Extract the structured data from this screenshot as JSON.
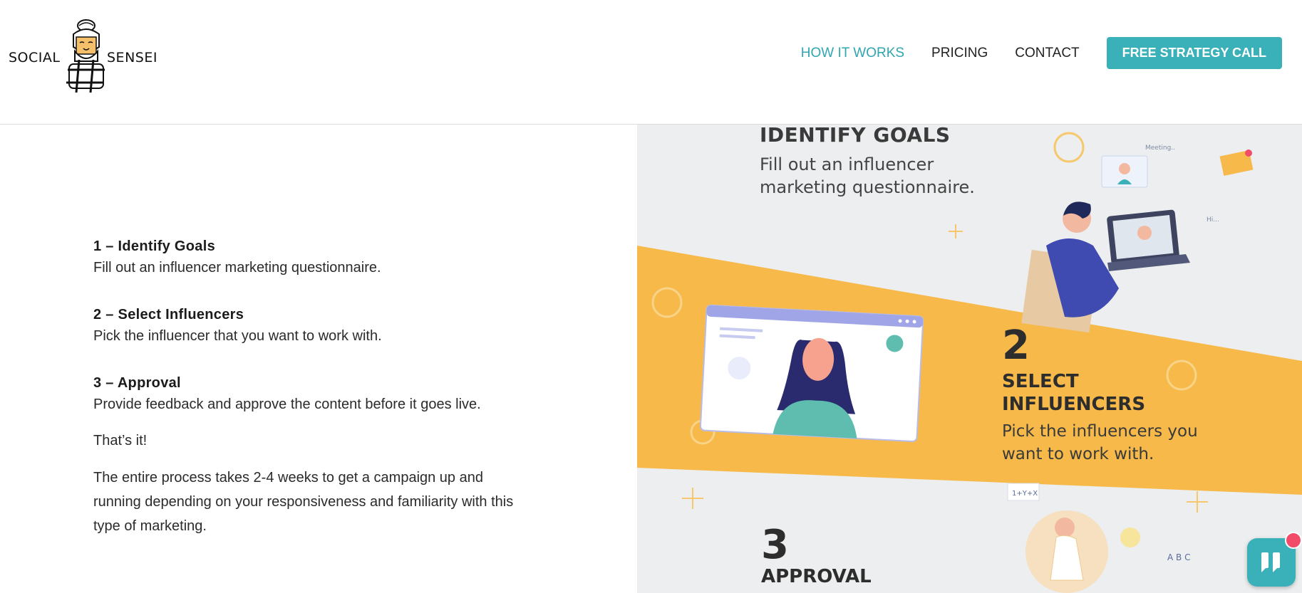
{
  "brand": {
    "left_word": "SOCIAL",
    "right_word": "SENSEI",
    "logo_icon": "sensei-hashtag-logo"
  },
  "nav": {
    "items": [
      {
        "label": "HOW IT WORKS",
        "active": true
      },
      {
        "label": "PRICING",
        "active": false
      },
      {
        "label": "CONTACT",
        "active": false
      }
    ],
    "cta": "FREE STRATEGY CALL"
  },
  "steps": [
    {
      "title": "1 – Identify Goals",
      "desc": "Fill out an influencer marketing questionnaire."
    },
    {
      "title": "2 – Select Influencers",
      "desc": "Pick the influencer that you want to work with."
    },
    {
      "title": "3 – Approval",
      "desc": "Provide feedback and approve the content before it goes live."
    }
  ],
  "paragraphs": {
    "thats_it": "That’s it!",
    "process": "The entire process takes 2-4 weeks to get a campaign up and running depending on your responsiveness and familiarity with this type of marketing."
  },
  "infographic": {
    "step1_title": "IDENTIFY GOALS",
    "step1_line1": "Fill out an influencer",
    "step1_line2": "marketing questionnaire.",
    "step2_number": "2",
    "step2_title1": "SELECT",
    "step2_title2": "INFLUENCERS",
    "step2_line1": "Pick the influencers you",
    "step2_line2": "want to work with.",
    "step3_number": "3",
    "step3_title": "APPROVAL",
    "board_text": "1+Y+X",
    "letters": "A B C",
    "screen_text1": "Meeting..",
    "screen_text2": "Hi...",
    "colors": {
      "yellow": "#f6b94a",
      "teal": "#3ab0b8",
      "bg": "#eceeef"
    }
  },
  "chat": {
    "icon": "chat-quote-icon",
    "badge": "notification-dot"
  },
  "colors": {
    "accent": "#3ab0b8",
    "nav_active": "#2fa6b0"
  }
}
